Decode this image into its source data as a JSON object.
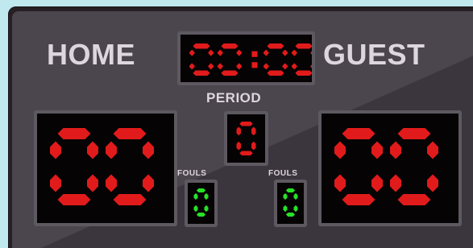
{
  "home_label": "HOME",
  "guest_label": "GUEST",
  "period_label": "PERIOD",
  "fouls_home_label": "FOULS",
  "fouls_guest_label": "FOULS",
  "clock": "00:00",
  "period": "0",
  "home_score": "00",
  "guest_score": "00",
  "home_fouls": "0",
  "guest_fouls": "0",
  "colors": {
    "score_red": "#e11b1b",
    "clock_red": "#e11b1b",
    "fouls_green": "#27e127",
    "label_text": "#ddd6de"
  }
}
